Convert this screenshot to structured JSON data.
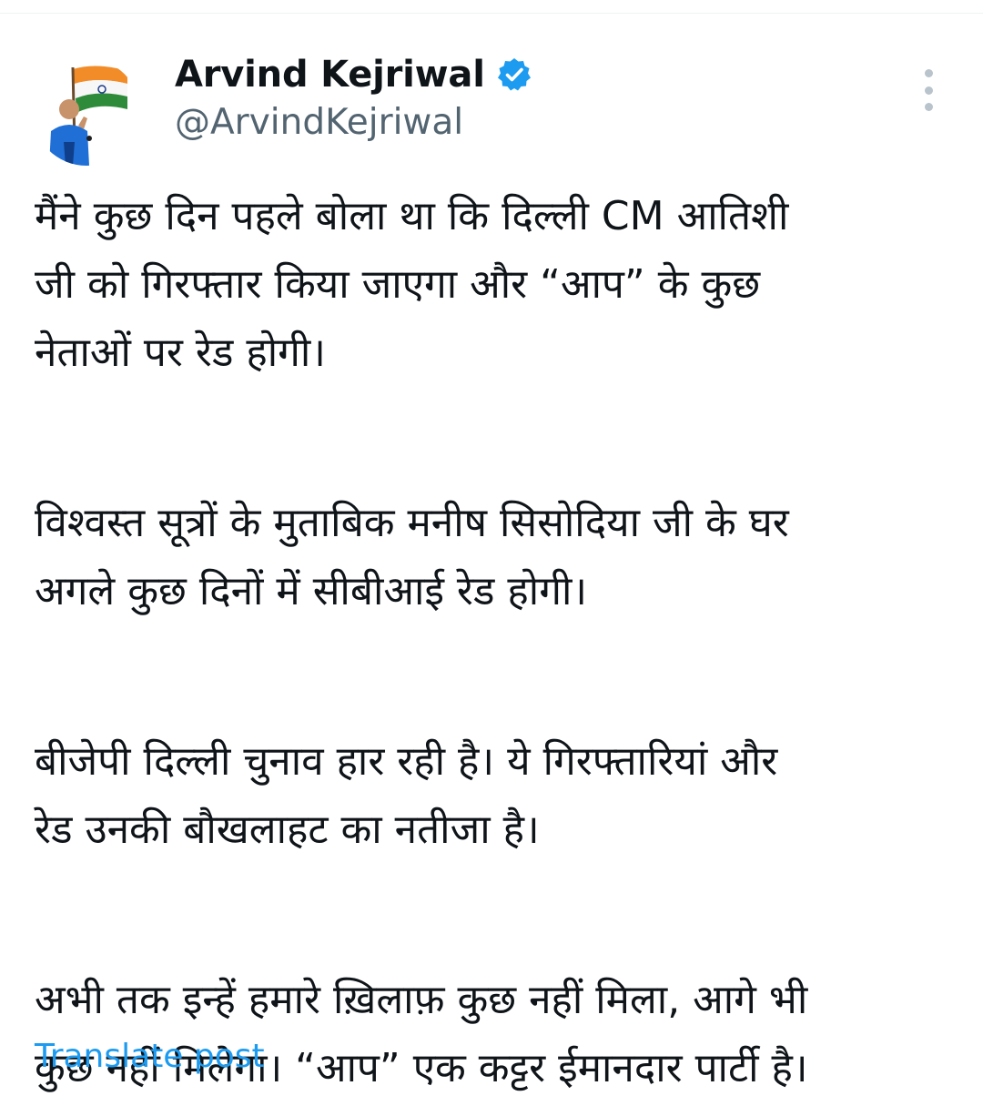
{
  "author": {
    "display_name": "Arvind Kejriwal",
    "handle": "@ArvindKejriwal",
    "verified_icon": "verified-badge-icon",
    "avatar": "profile-avatar",
    "accent_color": "#1d9bf0"
  },
  "more_menu_icon": "more-vertical-icon",
  "tweet": {
    "paragraphs": [
      "मैंने कुछ दिन पहले बोला था कि दिल्ली CM आतिशी\nजी को गिरफ्तार किया जाएगा और “आप” के कुछ\nनेताओं पर रेड होगी।",
      "विश्वस्त सूत्रों के मुताबिक मनीष सिसोदिया जी के घर\nअगले कुछ दिनों में सीबीआई रेड होगी।",
      "बीजेपी दिल्ली चुनाव हार रही है। ये गिरफ्तारियां और\nरेड उनकी बौखलाहट का नतीजा है।",
      "अभी तक इन्हें हमारे ख़िलाफ़ कुछ नहीं मिला, आगे भी\nकुछ नहीं मिलेगा। “आप” एक कट्टर ईमानदार पार्टी है।"
    ]
  },
  "translate_label": "Translate post"
}
